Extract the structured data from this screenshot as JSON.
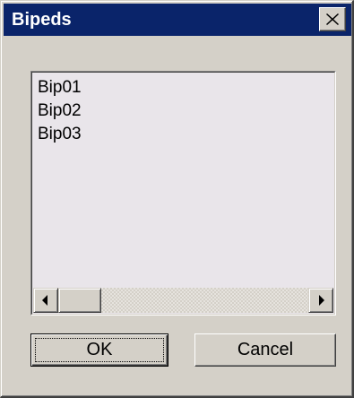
{
  "window": {
    "title": "Bipeds",
    "close_icon": "close-icon"
  },
  "list": {
    "items": [
      "Bip01",
      "Bip02",
      "Bip03"
    ],
    "scrollbar": {
      "left_icon": "arrow-left-icon",
      "right_icon": "arrow-right-icon"
    }
  },
  "buttons": {
    "ok_label": "OK",
    "cancel_label": "Cancel"
  }
}
